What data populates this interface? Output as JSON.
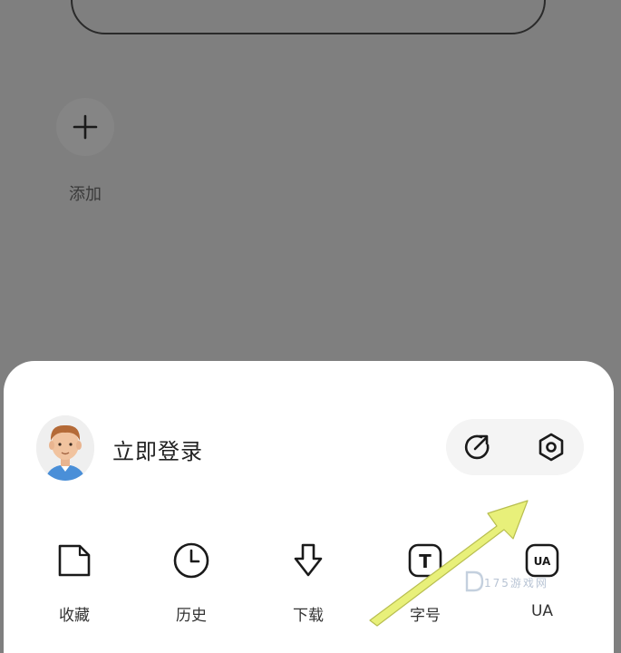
{
  "shortcuts": {
    "add_label": "添加"
  },
  "account": {
    "login_label": "立即登录"
  },
  "menu": {
    "items": [
      {
        "label": "收藏",
        "icon": "folder-icon"
      },
      {
        "label": "历史",
        "icon": "clock-icon"
      },
      {
        "label": "下载",
        "icon": "download-arrow-icon"
      },
      {
        "label": "字号",
        "icon": "font-size-icon"
      },
      {
        "label": "UA",
        "icon": "ua-icon"
      }
    ],
    "ua_badge": "UA",
    "font_badge": "T"
  },
  "watermark": {
    "text": "175游戏网"
  },
  "colors": {
    "backdrop": "#7f7f7f",
    "sheet": "#ffffff",
    "arrow": "#e8f07a"
  }
}
